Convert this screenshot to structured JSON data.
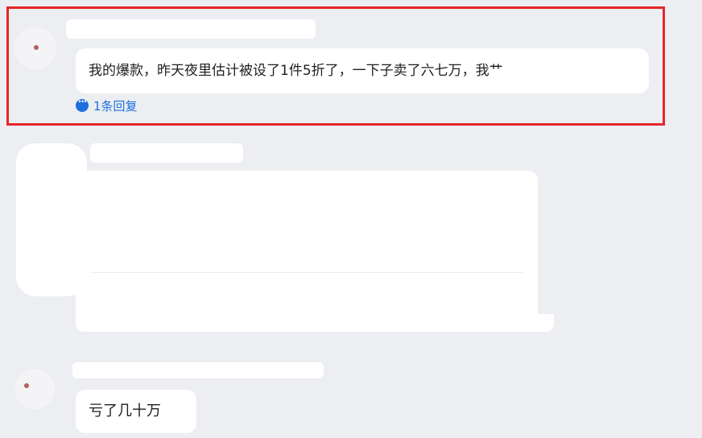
{
  "comments": [
    {
      "text": "我的爆款，昨天夜里估计被设了1件5折了，一下子卖了六七万，我艹",
      "reply_link": "1条回复",
      "reply_icon": "chat-bubble-icon",
      "highlighted": true,
      "highlight_color": "#e5252a"
    },
    {
      "text": "",
      "redacted": true
    },
    {
      "text": "亏了几十万"
    }
  ],
  "colors": {
    "background": "#eceef2",
    "bubble": "#ffffff",
    "link": "#1e6fde",
    "text": "#1f1f1f"
  }
}
